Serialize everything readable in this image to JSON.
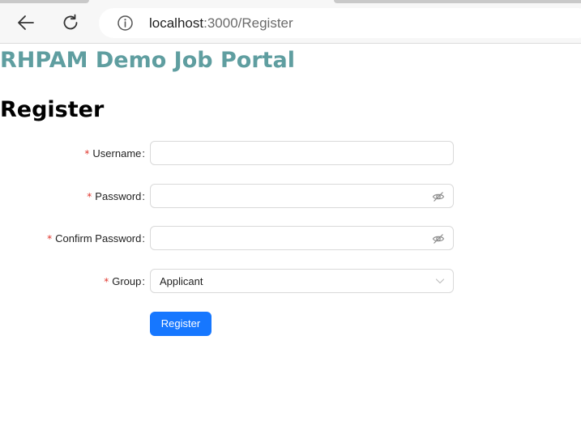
{
  "browser": {
    "url_host": "localhost",
    "url_rest": ":3000/Register",
    "back_icon": "arrow-left-icon",
    "reload_icon": "reload-icon",
    "info_icon": "info-circle-icon"
  },
  "page": {
    "portal_title": "RHPAM Demo Job Portal",
    "heading": "Register",
    "title_color": "#5f9ea0"
  },
  "form": {
    "required_mark": "*",
    "colon": ":",
    "username": {
      "label": "Username",
      "value": ""
    },
    "password": {
      "label": "Password",
      "value": "",
      "icon": "eye-invisible-icon"
    },
    "confirm_password": {
      "label": "Confirm Password",
      "value": "",
      "icon": "eye-invisible-icon"
    },
    "group": {
      "label": "Group",
      "value": "Applicant",
      "icon": "chevron-down-icon"
    },
    "submit_label": "Register",
    "accent_color": "#1677ff",
    "required_color": "#e0342b"
  }
}
